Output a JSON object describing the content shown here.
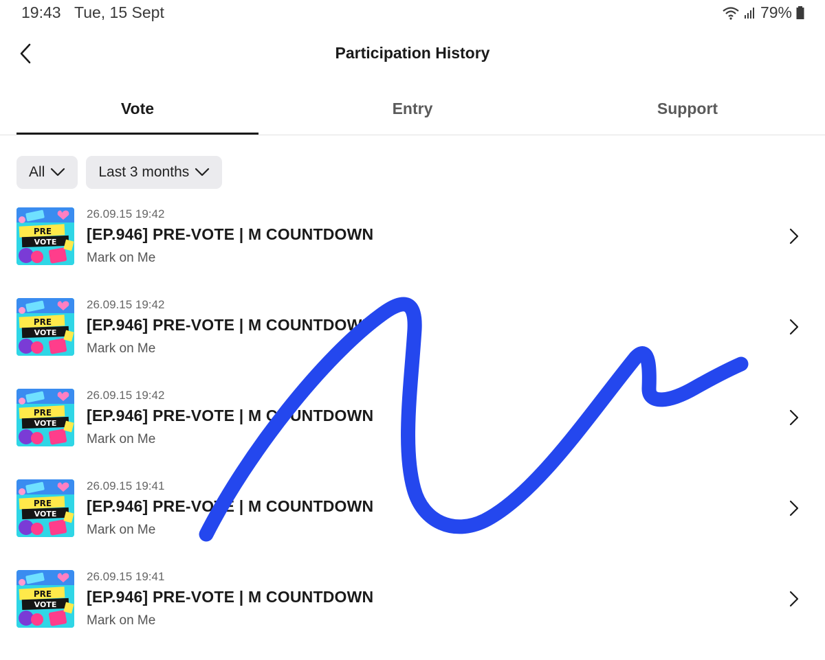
{
  "status_bar": {
    "time": "19:43",
    "date": "Tue, 15 Sept",
    "battery": "79%",
    "icons": [
      "wifi-icon",
      "signal-icon",
      "battery-icon"
    ]
  },
  "header": {
    "title": "Participation History",
    "back_icon": "chevron-left-icon"
  },
  "tabs": [
    {
      "label": "Vote",
      "active": true
    },
    {
      "label": "Entry",
      "active": false
    },
    {
      "label": "Support",
      "active": false
    }
  ],
  "filters": {
    "type": "All",
    "period": "Last 3 months",
    "icon": "chevron-down-icon"
  },
  "items": [
    {
      "date": "26.09.15 19:42",
      "title": "[EP.946] PRE-VOTE | M COUNTDOWN",
      "subtitle": "Mark on Me",
      "thumb_top": "PRE",
      "thumb_bottom": "VOTE"
    },
    {
      "date": "26.09.15 19:42",
      "title": "[EP.946] PRE-VOTE | M COUNTDOWN",
      "subtitle": "Mark on Me",
      "thumb_top": "PRE",
      "thumb_bottom": "VOTE"
    },
    {
      "date": "26.09.15 19:42",
      "title": "[EP.946] PRE-VOTE | M COUNTDOWN",
      "subtitle": "Mark on Me",
      "thumb_top": "PRE",
      "thumb_bottom": "VOTE"
    },
    {
      "date": "26.09.15 19:41",
      "title": "[EP.946] PRE-VOTE | M COUNTDOWN",
      "subtitle": "Mark on Me",
      "thumb_top": "PRE",
      "thumb_bottom": "VOTE"
    },
    {
      "date": "26.09.15 19:41",
      "title": "[EP.946] PRE-VOTE | M COUNTDOWN",
      "subtitle": "Mark on Me",
      "thumb_top": "PRE",
      "thumb_bottom": "VOTE"
    }
  ],
  "colors": {
    "scribble": "#2447ee",
    "thumb_bg": "#2fd6e6",
    "thumb_yellow": "#ffe94a",
    "thumb_pink": "#ff3d8b"
  }
}
